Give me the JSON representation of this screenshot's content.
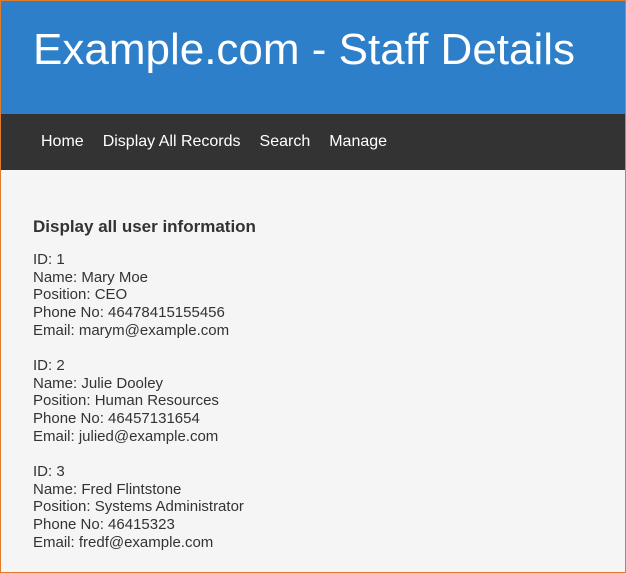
{
  "header": {
    "title": "Example.com - Staff Details"
  },
  "nav": {
    "items": [
      "Home",
      "Display All Records",
      "Search",
      "Manage"
    ]
  },
  "main": {
    "heading": "Display all user information",
    "records": [
      {
        "id": "ID: 1",
        "name": "Name: Mary Moe",
        "position": "Position: CEO",
        "phone": "Phone No: 46478415155456",
        "email": "Email: marym@example.com"
      },
      {
        "id": "ID: 2",
        "name": "Name: Julie Dooley",
        "position": "Position: Human Resources",
        "phone": "Phone No: 46457131654",
        "email": "Email: julied@example.com"
      },
      {
        "id": "ID: 3",
        "name": "Name: Fred Flintstone",
        "position": "Position: Systems Administrator",
        "phone": "Phone No: 46415323",
        "email": "Email: fredf@example.com"
      }
    ]
  },
  "colors": {
    "header_bg": "#2d7fc9",
    "nav_bg": "#333333",
    "page_bg": "#f5f5f5",
    "text": "#333333"
  }
}
